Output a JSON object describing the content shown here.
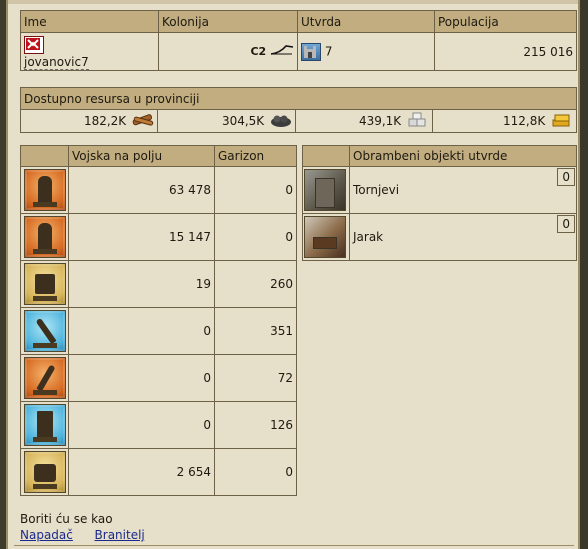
{
  "player_table": {
    "headers": [
      "Ime",
      "Kolonija",
      "Utvrda",
      "Populacija"
    ],
    "name": "jovanovic7",
    "colony": "C2",
    "fortress_level": "7",
    "population": "215 016"
  },
  "resources": {
    "title": "Dostupno resursa u provinciji",
    "items": [
      {
        "value": "182,2K",
        "icon": "wood-icon"
      },
      {
        "value": "304,5K",
        "icon": "ore-icon"
      },
      {
        "value": "439,1K",
        "icon": "stone-icon"
      },
      {
        "value": "112,8K",
        "icon": "gold-icon"
      }
    ]
  },
  "troops": {
    "headers": [
      "",
      "Vojska na polju",
      "Garizon"
    ],
    "rows": [
      {
        "icon": "spearman-icon",
        "bg": "orange",
        "field": "63 478",
        "garrison": "0"
      },
      {
        "icon": "swordsman-icon",
        "bg": "orange",
        "field": "15 147",
        "garrison": "0"
      },
      {
        "icon": "ballista-icon",
        "bg": "gold",
        "field": "19",
        "garrison": "260"
      },
      {
        "icon": "catapult-icon",
        "bg": "blue",
        "field": "0",
        "garrison": "351"
      },
      {
        "icon": "trebuchet-icon",
        "bg": "orange",
        "field": "0",
        "garrison": "72"
      },
      {
        "icon": "siege-tower-icon",
        "bg": "blue",
        "field": "0",
        "garrison": "126"
      },
      {
        "icon": "ram-icon",
        "bg": "gold",
        "field": "2 654",
        "garrison": "0"
      }
    ]
  },
  "defenses": {
    "headers": [
      "",
      "Obrambeni objekti utvrde"
    ],
    "rows": [
      {
        "icon": "tower-icon",
        "label": "Tornjevi",
        "level": "0"
      },
      {
        "icon": "moat-icon",
        "label": "Jarak",
        "level": "0"
      }
    ]
  },
  "fight_as": {
    "label": "Boriti ću se kao",
    "attacker": "Napadač",
    "defender": "Branitelj"
  },
  "colors": {
    "header_bg": "#c2ad80",
    "panel_bg": "#e6dfc9",
    "border": "#6d6148",
    "link": "#1a2a8c"
  }
}
